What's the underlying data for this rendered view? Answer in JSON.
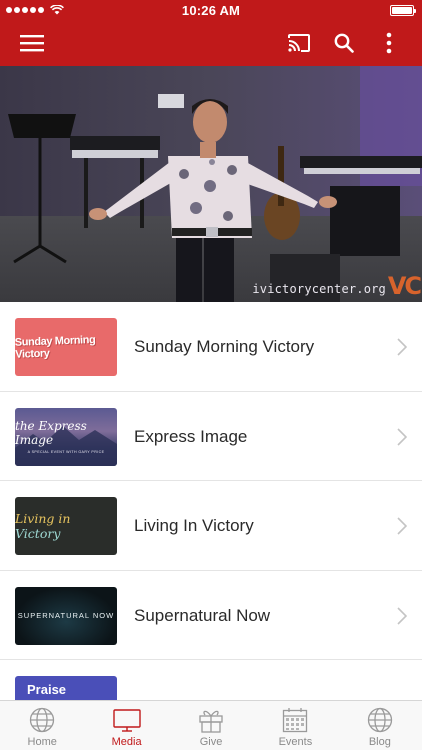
{
  "status_bar": {
    "time": "10:26 AM",
    "signal_dots": 5
  },
  "app_bar": {
    "background_color": "#c0191a",
    "icons": [
      "menu-icon",
      "cast-icon",
      "search-icon",
      "more-vertical-icon"
    ]
  },
  "hero": {
    "watermark": "ivictorycenter.org",
    "logo_mark": "VC"
  },
  "media_list": [
    {
      "title": "Sunday Morning Victory",
      "thumb_text": "Sunday Morning Victory"
    },
    {
      "title": "Express Image",
      "thumb_text": "the Express Image",
      "thumb_subtext": "A SPECIAL EVENT WITH GARY PRICE"
    },
    {
      "title": "Living In Victory",
      "thumb_text": "Living in",
      "thumb_text_2": "Victory"
    },
    {
      "title": "Supernatural Now",
      "thumb_text": "SUPERNATURAL NOW"
    },
    {
      "title": "",
      "thumb_text": "Praise"
    }
  ],
  "tab_bar": {
    "active_color": "#c0191a",
    "tabs": [
      {
        "label": "Home",
        "icon": "globe-icon"
      },
      {
        "label": "Media",
        "icon": "tv-icon",
        "active": true
      },
      {
        "label": "Give",
        "icon": "gift-icon"
      },
      {
        "label": "Events",
        "icon": "calendar-icon"
      },
      {
        "label": "Blog",
        "icon": "globe-icon"
      }
    ]
  }
}
